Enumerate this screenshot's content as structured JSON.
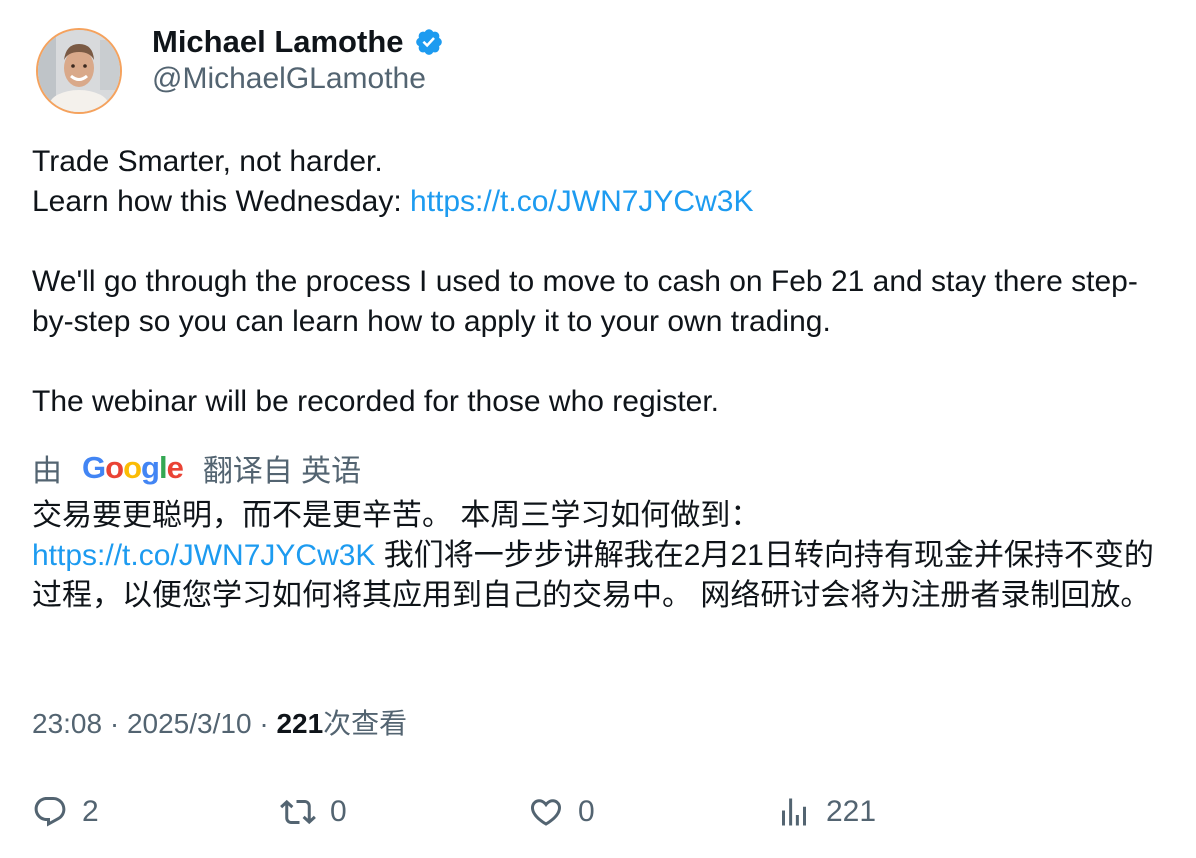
{
  "author": {
    "name": "Michael Lamothe",
    "handle": "@MichaelGLamothe"
  },
  "tweet": {
    "line1": "Trade Smarter, not harder.",
    "line2_prefix": "Learn how this Wednesday: ",
    "line2_link": "https://t.co/JWN7JYCw3K",
    "para2": "We'll go through the process I used to move to cash on Feb 21 and stay there step-by-step so you can learn how to apply it to your own trading.",
    "para3": "The webinar will be recorded for those who register."
  },
  "translation": {
    "by": "由",
    "provider": "Google",
    "from_label": "翻译自 英语",
    "text_before_link": "交易要更聪明，而不是更辛苦。 本周三学习如何做到：",
    "link": "https://t.co/JWN7JYCw3K",
    "text_after_link": " 我们将一步步讲解我在2月21日转向持有现金并保持不变的过程，以便您学习如何将其应用到自己的交易中。 网络研讨会将为注册者录制回放。"
  },
  "meta": {
    "time": "23:08",
    "date": "2025/3/10",
    "views_count": "221",
    "views_label": "次查看"
  },
  "actions": {
    "replies": "2",
    "reposts": "0",
    "likes": "0",
    "views": "221"
  },
  "colors": {
    "link": "#1d9bf0",
    "secondary": "#536471",
    "verified": "#1d9bf0"
  }
}
